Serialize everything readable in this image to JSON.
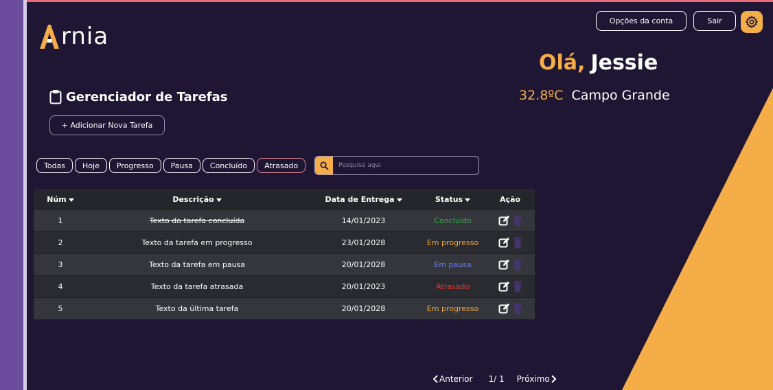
{
  "app": {
    "logo_text": "rnia"
  },
  "header": {
    "account_options_label": "Opções da conta",
    "logout_label": "Sair",
    "greeting_hello": "Olá,",
    "greeting_name": "Jessie",
    "temperature": "32.8ºC",
    "city": "Campo Grande"
  },
  "main": {
    "title": "Gerenciador de Tarefas",
    "add_task_label": "+ Adicionar Nova Tarefa",
    "filters": [
      "Todas",
      "Hoje",
      "Progresso",
      "Pausa",
      "Concluído",
      "Atrasado"
    ],
    "active_filter": "Atrasado",
    "search": {
      "placeholder": "Pesquise aqui"
    }
  },
  "table": {
    "headers": [
      "Núm",
      "Descrição",
      "Data de Entrega",
      "Status",
      "Ação"
    ],
    "rows": [
      {
        "num": "1",
        "description": "Texto da tarefa concluída",
        "date": "14/01/2023",
        "status": "Concluído"
      },
      {
        "num": "2",
        "description": "Texto da tarefa em progresso",
        "date": "23/01/2028",
        "status": "Em progresso"
      },
      {
        "num": "3",
        "description": "Texto da tarefa em pausa",
        "date": "20/01/2028",
        "status": "Em pausa"
      },
      {
        "num": "4",
        "description": "Texto da tarefa atrasada",
        "date": "20/01/2023",
        "status": "Atrasado"
      },
      {
        "num": "5",
        "description": "Texto da última tarefa",
        "date": "20/01/2028",
        "status": "Em progresso"
      }
    ]
  },
  "pagination": {
    "prev_label": "Anterior",
    "page_info": "1/ 1",
    "next_label": "Próximo"
  },
  "colors": {
    "background": "#1f1634",
    "accent": "#f5ad48",
    "sidebar": "#6c4c9c",
    "done": "#37b24d",
    "progress": "#f5a63a",
    "pause": "#6b7cff",
    "late": "#e53935"
  },
  "icons": [
    "clipboard-icon",
    "gear-icon",
    "search-icon",
    "edit-icon",
    "trash-icon",
    "chevron-left-icon",
    "chevron-right-icon"
  ]
}
